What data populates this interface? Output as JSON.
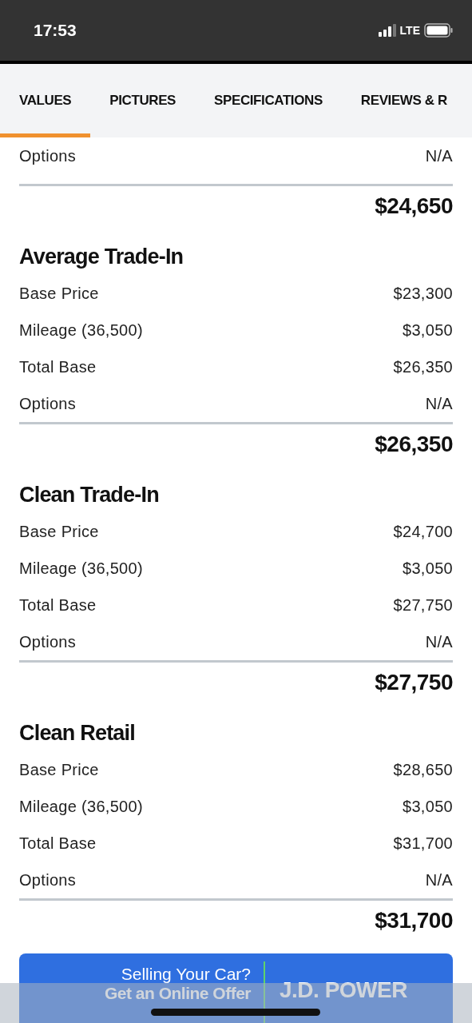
{
  "status_bar": {
    "time": "17:53",
    "network": "LTE"
  },
  "tabs": [
    {
      "label": "VALUES",
      "selected": true
    },
    {
      "label": "PICTURES",
      "selected": false
    },
    {
      "label": "SPECIFICATIONS",
      "selected": false
    },
    {
      "label": "REVIEWS & R",
      "selected": false
    }
  ],
  "sections": [
    {
      "rows": [
        {
          "label": "Options",
          "value": "N/A"
        }
      ],
      "total": "$24,650"
    },
    {
      "title": "Average Trade-In",
      "rows": [
        {
          "label": "Base Price",
          "value": "$23,300"
        },
        {
          "label": "Mileage (36,500)",
          "value": "$3,050"
        },
        {
          "label": "Total Base",
          "value": "$26,350"
        },
        {
          "label": "Options",
          "value": "N/A"
        }
      ],
      "total": "$26,350"
    },
    {
      "title": "Clean Trade-In",
      "rows": [
        {
          "label": "Base Price",
          "value": "$24,700"
        },
        {
          "label": "Mileage (36,500)",
          "value": "$3,050"
        },
        {
          "label": "Total Base",
          "value": "$27,750"
        },
        {
          "label": "Options",
          "value": "N/A"
        }
      ],
      "total": "$27,750"
    },
    {
      "title": "Clean Retail",
      "rows": [
        {
          "label": "Base Price",
          "value": "$28,650"
        },
        {
          "label": "Mileage (36,500)",
          "value": "$3,050"
        },
        {
          "label": "Total Base",
          "value": "$31,700"
        },
        {
          "label": "Options",
          "value": "N/A"
        }
      ],
      "total": "$31,700"
    }
  ],
  "offer_banner": {
    "line_1": "Selling Your Car?",
    "line_2": "Get an Online Offer",
    "brand": "J.D. POWER"
  }
}
